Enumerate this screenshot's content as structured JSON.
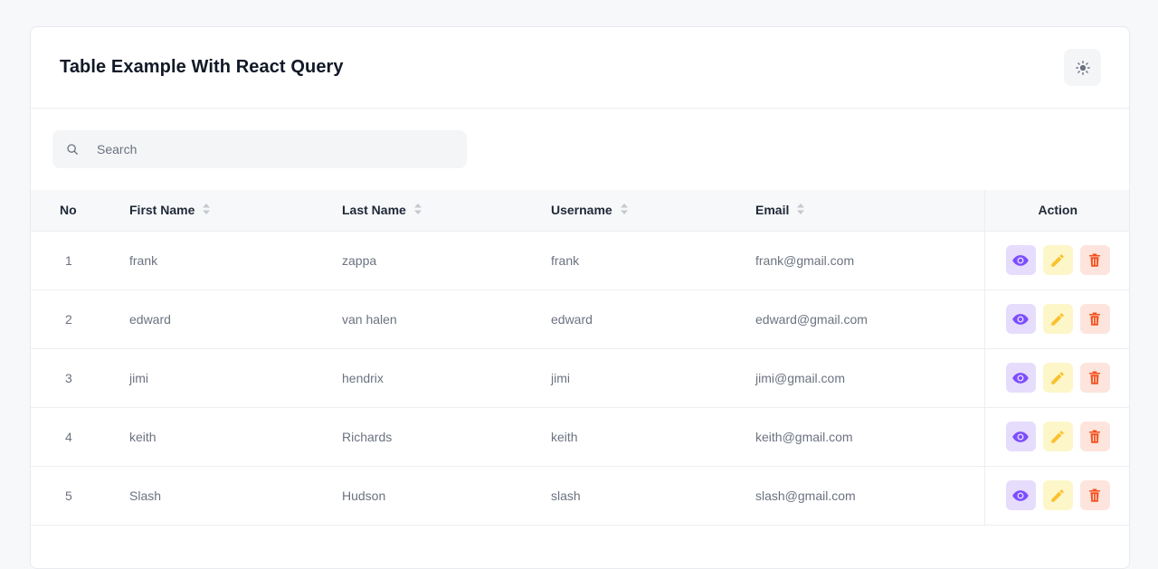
{
  "header": {
    "title": "Table Example With React Query"
  },
  "search": {
    "placeholder": "Search"
  },
  "table": {
    "columns": {
      "no": "No",
      "first_name": "First Name",
      "last_name": "Last Name",
      "username": "Username",
      "email": "Email",
      "action": "Action"
    },
    "rows": [
      {
        "no": "1",
        "first_name": "frank",
        "last_name": "zappa",
        "username": "frank",
        "email": "frank@gmail.com"
      },
      {
        "no": "2",
        "first_name": "edward",
        "last_name": "van halen",
        "username": "edward",
        "email": "edward@gmail.com"
      },
      {
        "no": "3",
        "first_name": "jimi",
        "last_name": "hendrix",
        "username": "jimi",
        "email": "jimi@gmail.com"
      },
      {
        "no": "4",
        "first_name": "keith",
        "last_name": "Richards",
        "username": "keith",
        "email": "keith@gmail.com"
      },
      {
        "no": "5",
        "first_name": "Slash",
        "last_name": "Hudson",
        "username": "slash",
        "email": "slash@gmail.com"
      }
    ]
  },
  "icons": {
    "theme": "sun-icon",
    "search": "search-icon",
    "sort": "sort-icon",
    "view": "eye-icon",
    "edit": "pencil-icon",
    "delete": "trash-icon"
  },
  "colors": {
    "view": "#7c4dff",
    "edit": "#fbc02d",
    "delete": "#f4511e"
  }
}
